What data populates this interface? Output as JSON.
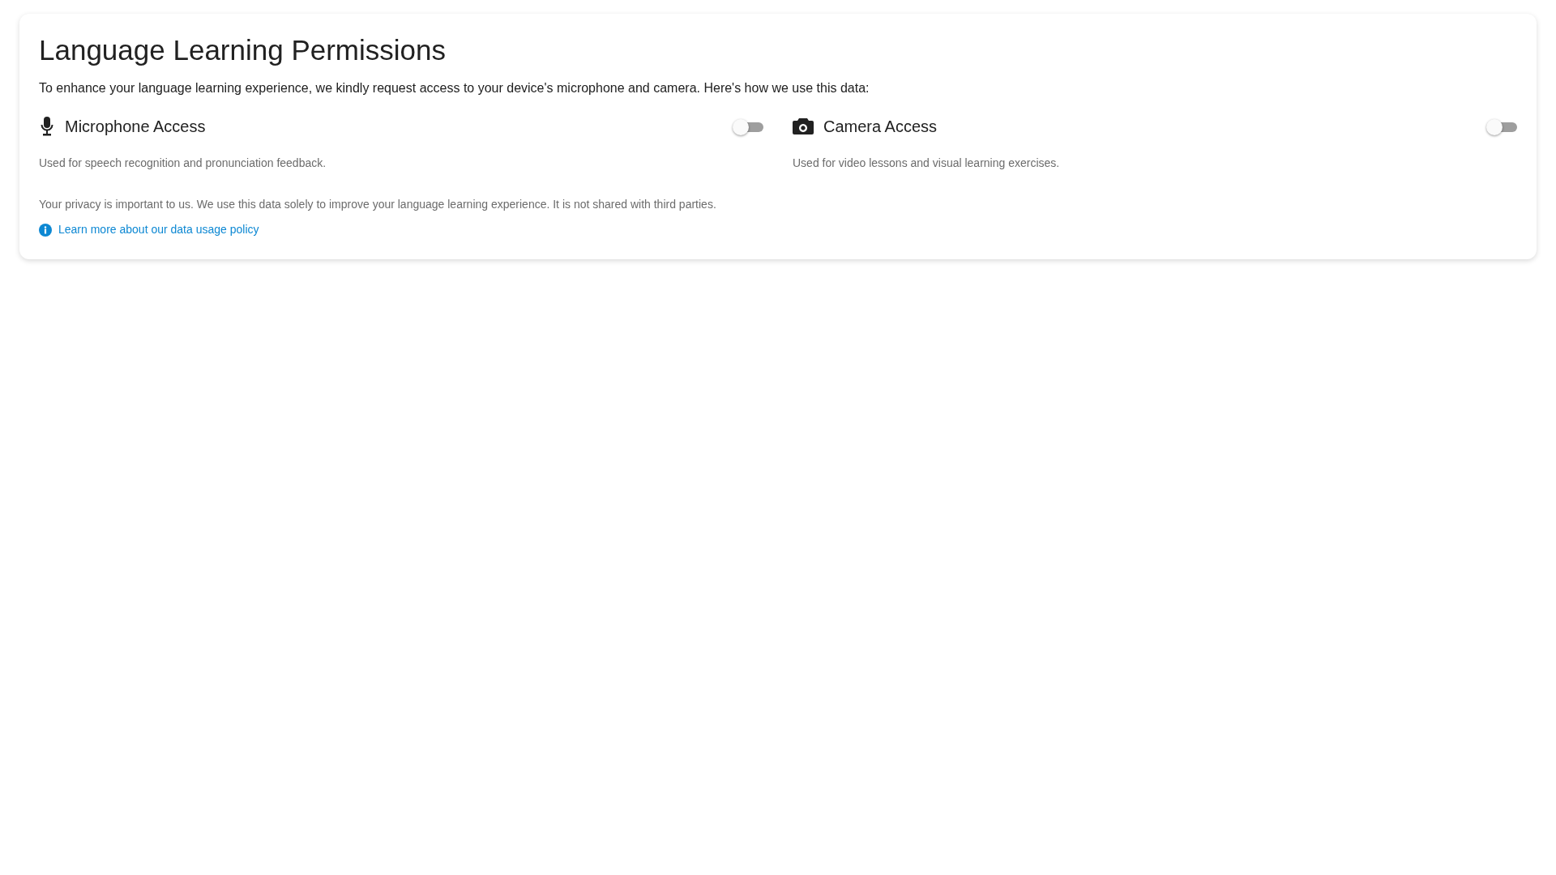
{
  "title": "Language Learning Permissions",
  "intro": "To enhance your language learning experience, we kindly request access to your device's microphone and camera. Here's how we use this data:",
  "permissions": [
    {
      "kind": "microphone",
      "label": "Microphone Access",
      "on": false,
      "description": "Used for speech recognition and pronunciation feedback."
    },
    {
      "kind": "camera",
      "label": "Camera Access",
      "on": false,
      "description": "Used for video lessons and visual learning exercises."
    }
  ],
  "privacy_note": "Your privacy is important to us. We use this data solely to improve your language learning experience. It is not shared with third parties.",
  "policy_link": "Learn more about our data usage policy"
}
